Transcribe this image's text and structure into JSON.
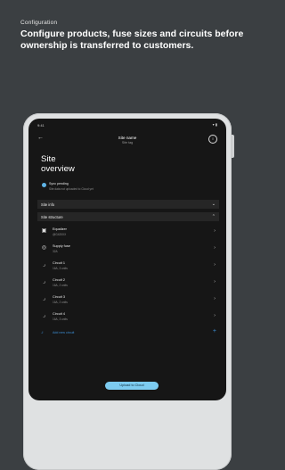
{
  "caption": {
    "kicker": "Configuration",
    "headline": "Configure products, fuse sizes and circuits before ownership is transferred to customers."
  },
  "status_bar": {
    "time": "9:41",
    "icons": "▾ ▮"
  },
  "app_bar": {
    "title": "Site name",
    "subtitle": "Site tag"
  },
  "page": {
    "title_line1": "Site",
    "title_line2": "overview"
  },
  "sync": {
    "title": "Sync pending",
    "detail": "Site data not uploaded to Cloud yet"
  },
  "sections": [
    {
      "label": "Site info",
      "expanded": false
    },
    {
      "label": "Site structure",
      "expanded": true
    }
  ],
  "items": [
    {
      "icon": "equalizer-icon",
      "name": "Equalizer",
      "sub": "@G420XX"
    },
    {
      "icon": "supply-fuse-icon",
      "name": "Supply fuse",
      "sub": "32A"
    },
    {
      "icon": "circuit-icon",
      "name": "Circuit 1",
      "sub": "16A, 3 units"
    },
    {
      "icon": "circuit-icon",
      "name": "Circuit 2",
      "sub": "16A, 2 units"
    },
    {
      "icon": "circuit-icon",
      "name": "Circuit 3",
      "sub": "16A, 2 units"
    },
    {
      "icon": "circuit-icon",
      "name": "Circuit 4",
      "sub": "16A, 3 units"
    }
  ],
  "add_circuit": {
    "label": "Add new circuit"
  },
  "upload_button": {
    "label": "Upload to Cloud",
    "color": "#7dcbf0"
  },
  "colors": {
    "background": "#3b3f42",
    "screen": "#161616",
    "accent": "#3d8fd6",
    "sync_dot": "#5fb4e6"
  }
}
